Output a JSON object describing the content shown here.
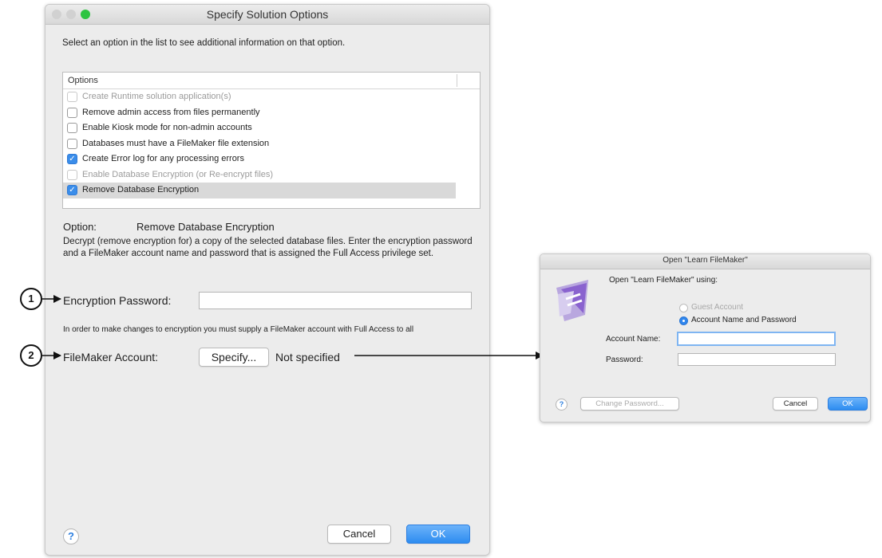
{
  "main_dialog": {
    "title": "Specify Solution Options",
    "instruction": "Select an option in the list to see additional information on that option.",
    "options_header": "Options",
    "options": [
      {
        "label": "Create Runtime solution application(s)",
        "checked": false,
        "enabled": false
      },
      {
        "label": "Remove admin access from files permanently",
        "checked": false,
        "enabled": true
      },
      {
        "label": "Enable Kiosk mode for non-admin accounts",
        "checked": false,
        "enabled": true
      },
      {
        "label": "Databases must have a FileMaker file extension",
        "checked": false,
        "enabled": true
      },
      {
        "label": "Create Error log for any processing errors",
        "checked": true,
        "enabled": true
      },
      {
        "label": "Enable Database Encryption (or Re-encrypt files)",
        "checked": false,
        "enabled": false
      },
      {
        "label": "Remove Database Encryption",
        "checked": true,
        "enabled": true,
        "selected": true
      }
    ],
    "option_label": "Option:",
    "option_value": "Remove Database Encryption",
    "description": "Decrypt (remove encryption for) a copy of the selected database files. Enter the encryption password and a FileMaker account name and password that is assigned the Full Access privilege set.",
    "encryption_password_label": "Encryption Password:",
    "encryption_password_value": "",
    "note": "In order to make changes to encryption you must supply a FileMaker account with Full Access to all",
    "filemaker_account_label": "FileMaker Account:",
    "specify_label": "Specify...",
    "account_status": "Not specified",
    "help_label": "?",
    "cancel_label": "Cancel",
    "ok_label": "OK"
  },
  "callouts": [
    "1",
    "2"
  ],
  "login_dialog": {
    "title": "Open \"Learn FileMaker\"",
    "heading": "Open \"Learn FileMaker\" using:",
    "guest_label": "Guest Account",
    "account_option_label": "Account Name and Password",
    "account_name_label": "Account Name:",
    "account_name_value": "",
    "password_label": "Password:",
    "password_value": "",
    "help_label": "?",
    "change_password_label": "Change Password...",
    "cancel_label": "Cancel",
    "ok_label": "OK"
  },
  "colors": {
    "accent": "#2d8cf0",
    "checkbox_on": "#3a8dea",
    "window_bg": "#ececec",
    "selected_row": "#d9d9d9"
  },
  "icons": [
    "close-traffic-light",
    "minimize-traffic-light",
    "zoom-traffic-light",
    "filemaker-logo-icon",
    "help-icon",
    "arrow-icon"
  ]
}
